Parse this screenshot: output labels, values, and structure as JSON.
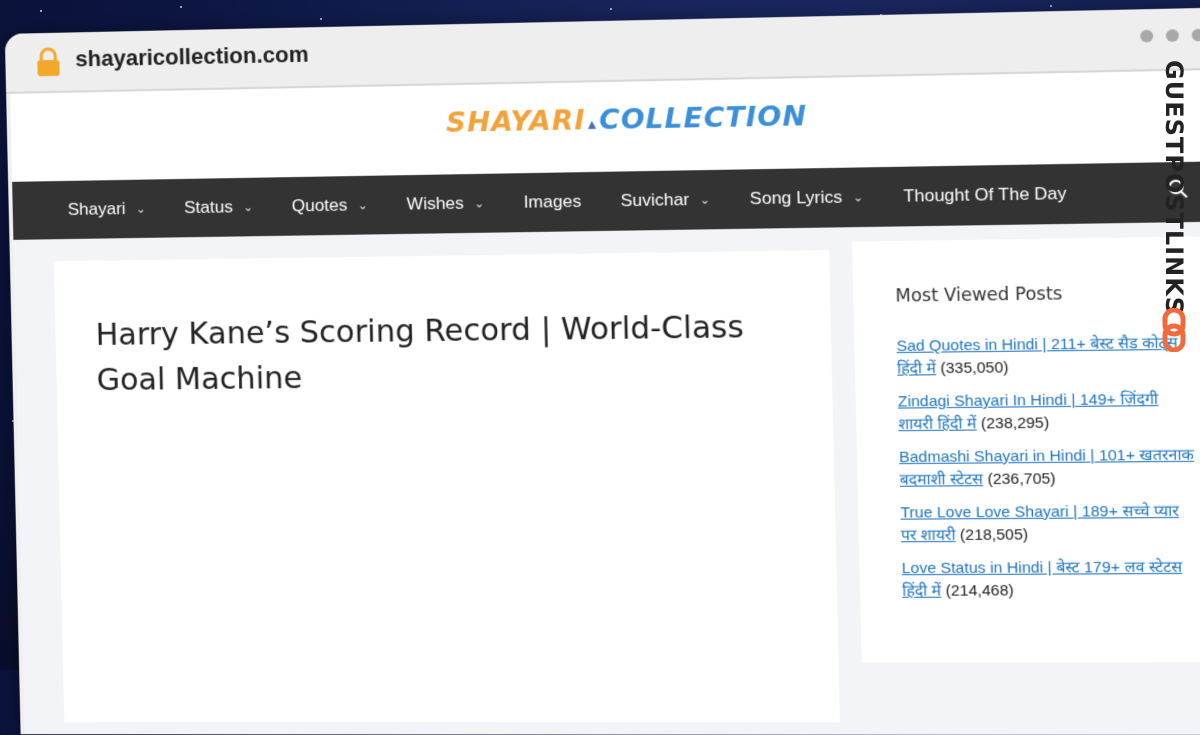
{
  "browser": {
    "url": "shayaricollection.com"
  },
  "logo": {
    "part1": "SHAYARI",
    "part2": "COLLECTION"
  },
  "nav": {
    "items": [
      {
        "label": "Shayari",
        "dropdown": true
      },
      {
        "label": "Status",
        "dropdown": true
      },
      {
        "label": "Quotes",
        "dropdown": true
      },
      {
        "label": "Wishes",
        "dropdown": true
      },
      {
        "label": "Images",
        "dropdown": false
      },
      {
        "label": "Suvichar",
        "dropdown": true
      },
      {
        "label": "Song Lyrics",
        "dropdown": true
      },
      {
        "label": "Thought Of The Day",
        "dropdown": false
      }
    ]
  },
  "article": {
    "title": "Harry Kane’s Scoring Record | World-Class Goal Machine"
  },
  "sidebar": {
    "heading": "Most Viewed Posts",
    "posts": [
      {
        "title": "Sad Quotes in Hindi | 211+ बेस्ट सैड कोट्स हिंदी में",
        "views": "(335,050)"
      },
      {
        "title": "Zindagi Shayari In Hindi | 149+ ज़िंदगी शायरी हिंदी में",
        "views": "(238,295)"
      },
      {
        "title": "Badmashi Shayari in Hindi | 101+ खतरनाक बदमाशी स्टेटस",
        "views": "(236,705)"
      },
      {
        "title": "True Love Love Shayari | 189+ सच्चे प्यार पर शायरी",
        "views": "(218,505)"
      },
      {
        "title": "Love Status in Hindi | बेस्ट 179+ लव स्टेटस हिंदी में",
        "views": "(214,468)"
      }
    ]
  },
  "watermark": {
    "text": "GUESTPOSTLINKS"
  },
  "colors": {
    "nav_bg": "#333333",
    "link": "#1e73be",
    "logo_orange": "#f2a23a",
    "logo_blue": "#3a8fd8",
    "watermark_accent": "#f26a3a"
  }
}
